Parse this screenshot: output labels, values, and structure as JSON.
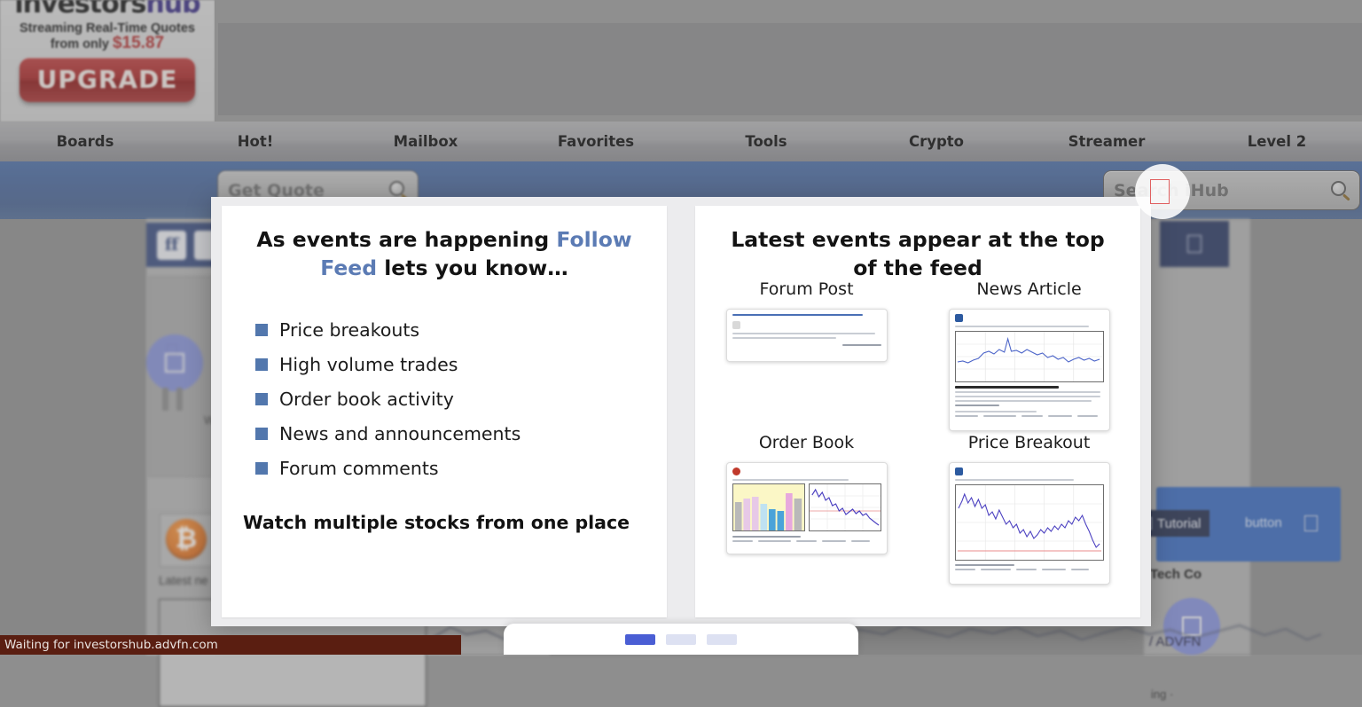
{
  "promo": {
    "logo_text": "investors",
    "logo_text_accent": "hub",
    "line1": "Streaming Real-Time Quotes",
    "line2_prefix": "from only ",
    "price": "$15.87",
    "button_label": "UPGRADE"
  },
  "nav": {
    "items": [
      {
        "label": "Boards"
      },
      {
        "label": "Hot!"
      },
      {
        "label": "Mailbox"
      },
      {
        "label": "Favorites"
      },
      {
        "label": "Tools"
      },
      {
        "label": "Crypto"
      },
      {
        "label": "Streamer"
      },
      {
        "label": "Level 2"
      }
    ]
  },
  "search": {
    "quote_placeholder": "Get Quote",
    "site_placeholder": "Search iHub",
    "quote_icon": "magnifier-icon",
    "site_icon": "magnifier-icon"
  },
  "background": {
    "social_icon_1": "ff",
    "video_play_icon": "play-circle-icon",
    "panel_blurb": "W... yo... ov...",
    "news_label": "Latest ne",
    "crypto_icon": "bitcoin-icon",
    "tutorial_tag": "Tutorial",
    "tutorial_word": "button",
    "tech_co": "Tech Co",
    "advfn": "/ ADVFN",
    "trailing_text": "ing ·"
  },
  "modal": {
    "left": {
      "heading_part1": "As events are happening ",
      "heading_highlight": "Follow Feed",
      "heading_part2": " lets you know…",
      "bullets": [
        {
          "label": "Price breakouts"
        },
        {
          "label": "High volume trades"
        },
        {
          "label": "Order book activity"
        },
        {
          "label": "News and announcements"
        },
        {
          "label": "Forum comments"
        }
      ],
      "footnote": "Watch multiple stocks from one place",
      "bullet_color": "#5277ad",
      "highlight_color": "#5b7bb4"
    },
    "right": {
      "heading": "Latest events appear at the top of the feed",
      "thumbs": [
        {
          "title": "Forum Post",
          "kind": "forum-post-thumbnail"
        },
        {
          "title": "News Article",
          "kind": "news-article-thumbnail"
        },
        {
          "title": "Order Book",
          "kind": "order-book-thumbnail"
        },
        {
          "title": "Price Breakout",
          "kind": "price-breakout-thumbnail"
        }
      ]
    }
  },
  "pager": {
    "dots": [
      {
        "state": "active"
      },
      {
        "state": "inactive"
      },
      {
        "state": "inactive"
      }
    ],
    "active_color": "#4a5ed4",
    "inactive_color": "#dde1f2"
  },
  "status": {
    "message": "Waiting for investorshub.advfn.com"
  },
  "cursor": {
    "icon": "text-caret-cursor"
  }
}
